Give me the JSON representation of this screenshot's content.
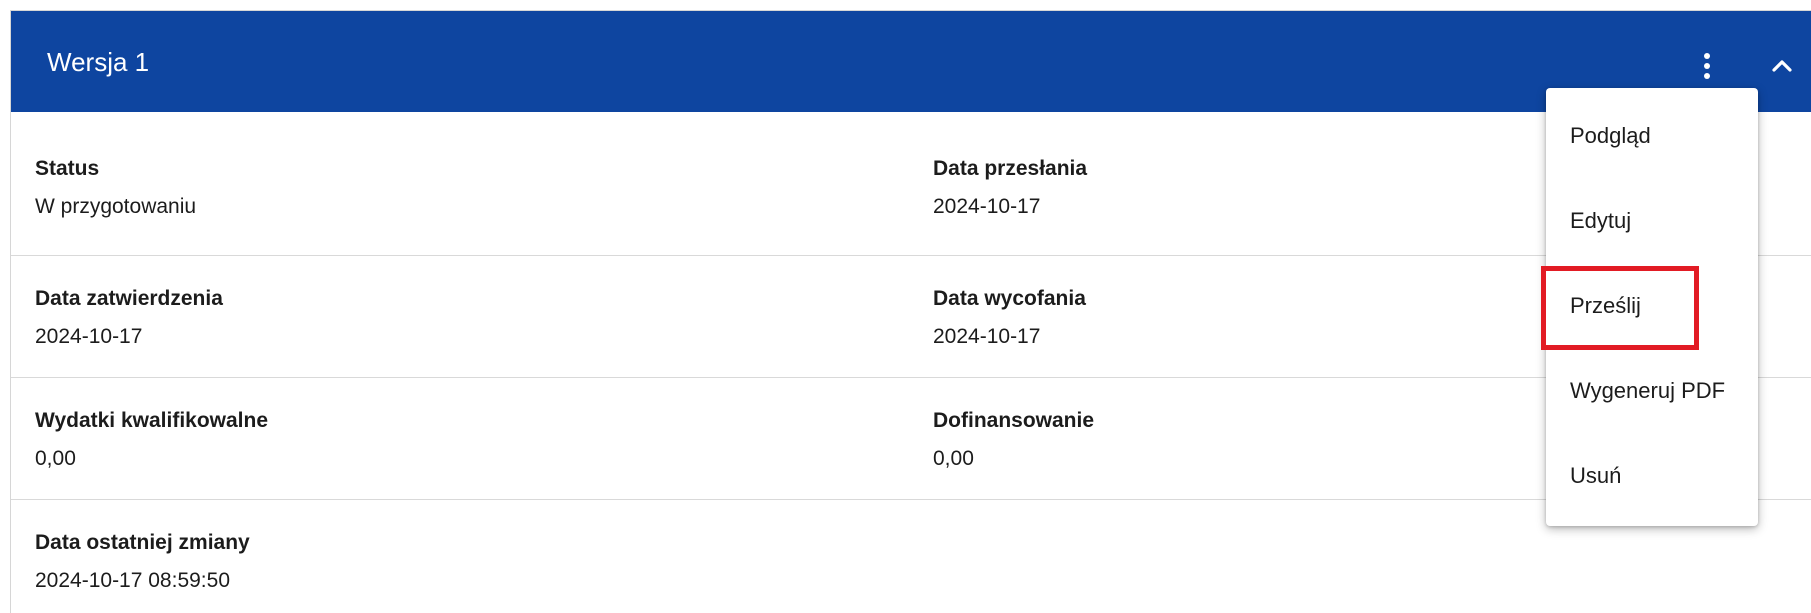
{
  "card": {
    "title": "Wersja 1",
    "header_color": "#0e45a0"
  },
  "header_actions": {
    "more_icon": "more-vertical-icon",
    "collapse_icon": "chevron-up-icon"
  },
  "fields": {
    "status": {
      "label": "Status",
      "value": "W przygotowaniu"
    },
    "data_przeslania": {
      "label": "Data przesłania",
      "value": "2024-10-17"
    },
    "data_zatwierdzenia": {
      "label": "Data zatwierdzenia",
      "value": "2024-10-17"
    },
    "data_wycofania": {
      "label": "Data wycofania",
      "value": "2024-10-17"
    },
    "wydatki": {
      "label": "Wydatki kwalifikowalne",
      "value": "0,00"
    },
    "dofinansowanie": {
      "label": "Dofinansowanie",
      "value": "0,00"
    },
    "data_zmiany": {
      "label": "Data ostatniej zmiany",
      "value": "2024-10-17 08:59:50"
    }
  },
  "menu": {
    "items": [
      {
        "label": "Podgląd"
      },
      {
        "label": "Edytuj"
      },
      {
        "label": "Prześlij",
        "highlighted": true
      },
      {
        "label": "Wygeneruj PDF"
      },
      {
        "label": "Usuń"
      }
    ],
    "highlight_color": "#e21b24"
  }
}
